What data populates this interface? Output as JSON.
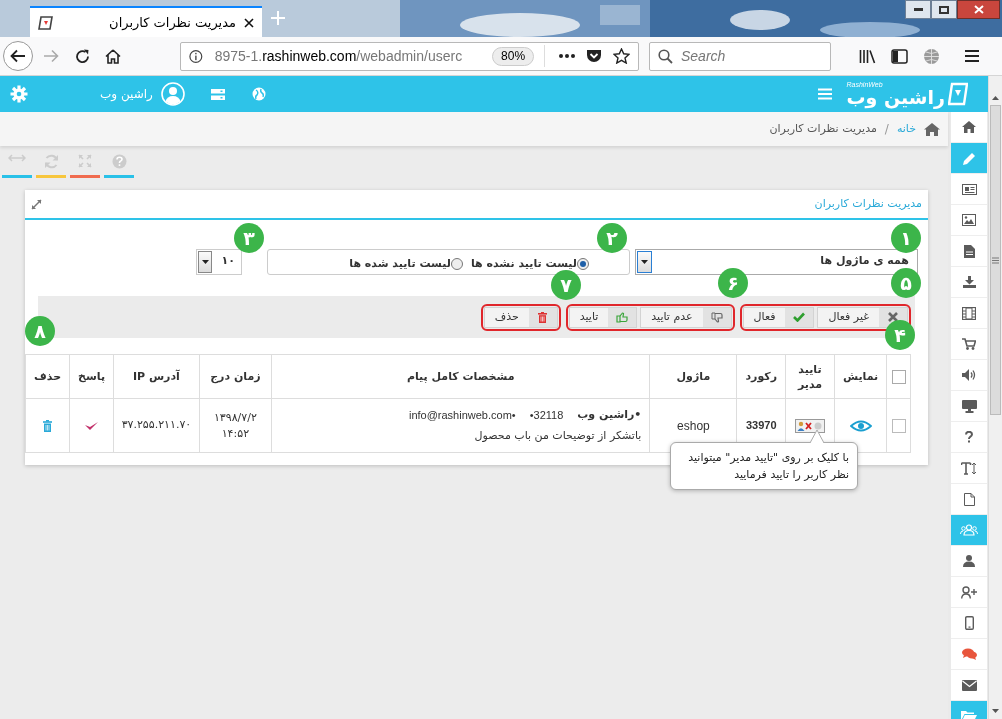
{
  "browser": {
    "tab_title": "مدیریت نظرات کاربران",
    "url_host": "8975-1.",
    "url_domain": "rashinweb.com",
    "url_path": "/webadmin/userc",
    "zoom": "80%",
    "search_placeholder": "Search"
  },
  "header": {
    "logo_text": "راشین وب",
    "logo_subtext": "RashinWeb",
    "user_name": "راشین وب"
  },
  "breadcrumb_separator": "/",
  "breadcrumb": [
    {
      "label": "خانه",
      "link": true
    },
    {
      "label": "مدیریت نظرات کاربران",
      "link": false
    }
  ],
  "toolbar_buttons": [
    {
      "color": "#29c1e8"
    },
    {
      "color": "#f7c63d"
    },
    {
      "color": "#f06b4f"
    },
    {
      "color": "#29c1e8"
    }
  ],
  "sidebar": {
    "items": [
      {
        "selected": false
      },
      {
        "selected": true
      },
      {
        "selected": false
      },
      {
        "selected": false
      },
      {
        "selected": false
      },
      {
        "selected": false
      },
      {
        "selected": false
      },
      {
        "selected": false
      },
      {
        "selected": false
      },
      {
        "selected": false
      },
      {
        "selected": false
      },
      {
        "selected": false
      },
      {
        "selected": false
      },
      {
        "selected": true
      },
      {
        "selected": false
      },
      {
        "selected": false
      },
      {
        "selected": false
      },
      {
        "selected": false
      },
      {
        "selected": false
      },
      {
        "selected": true
      }
    ]
  },
  "panel": {
    "title": "مدیریت نظرات کاربران",
    "module_select": {
      "value": "همه ی ماژول ها"
    },
    "list_filter": [
      {
        "label": "لیست تایید نشده ها",
        "selected": true
      },
      {
        "label": "لیست تایید شده ها",
        "selected": false
      }
    ],
    "page_size": {
      "value": "۱۰"
    },
    "action_groups": [
      {
        "buttons": [
          {
            "kind": "deactivate",
            "label": "غیر فعال"
          },
          {
            "kind": "activate",
            "label": "فعال"
          }
        ]
      },
      {
        "buttons": [
          {
            "kind": "reject",
            "label": "عدم تایید"
          },
          {
            "kind": "approve",
            "label": "تایید"
          }
        ]
      },
      {
        "buttons": [
          {
            "kind": "delete",
            "label": "حذف"
          }
        ]
      }
    ],
    "table": {
      "header_checked": false,
      "columns": [
        "نمایش",
        "تایید مدیر",
        "رکورد",
        "ماژول",
        "مشخصات کامل پیام",
        "زمان درج",
        "آدرس IP",
        "پاسخ",
        "حذف"
      ],
      "rows": [
        {
          "checked": false,
          "approved": false,
          "record": "33970",
          "module": "eshop",
          "sender": "•راشین وب",
          "phone": "•32118",
          "email": "info@rashinweb.com•",
          "message": "باتشکر از توضیحات من باب محصول",
          "date": "۱۳۹۸/۷/۲",
          "time": "۱۴:۵۲",
          "ip": "۳۷.۲۵۵.۲۱۱.۷۰"
        }
      ]
    }
  },
  "tooltip": "با کلیک بر روی \"تایید مدیر\" میتوانید نظر کاربر را تایید فرمایید",
  "markers": [
    "۱",
    "۲",
    "۳",
    "۴",
    "۵",
    "۶",
    "۷",
    "۸"
  ]
}
